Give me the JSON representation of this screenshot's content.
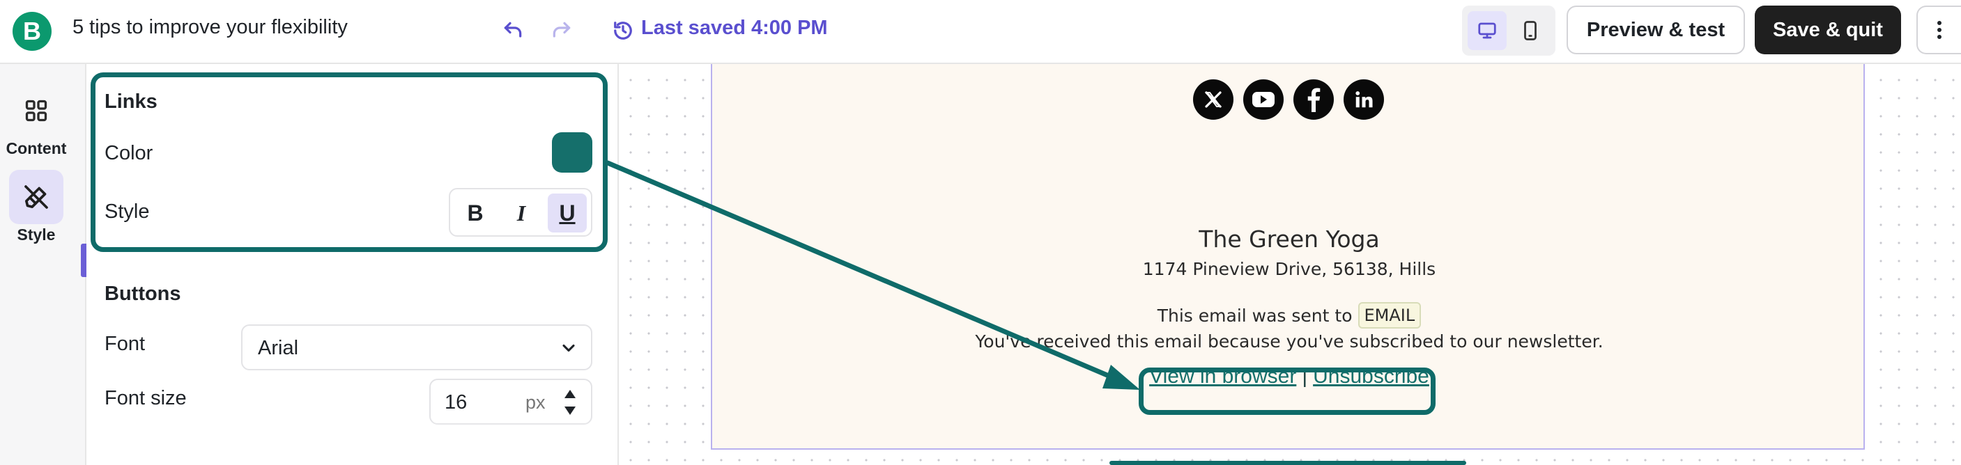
{
  "app": {
    "logo_letter": "B",
    "document_title": "5 tips to improve your flexibility",
    "last_saved": "Last saved 4:00 PM"
  },
  "toolbar": {
    "undo_icon": "undo-icon",
    "redo_icon": "redo-icon",
    "history_icon": "history-icon",
    "device_options": [
      "desktop",
      "mobile"
    ],
    "active_device": "desktop",
    "preview_label": "Preview & test",
    "save_label": "Save & quit",
    "more_icon": "more-vertical-icon"
  },
  "rail": {
    "items": [
      {
        "label": "Content",
        "icon": "grid-icon",
        "active": false
      },
      {
        "label": "Style",
        "icon": "paintbrush-icon",
        "active": true
      }
    ]
  },
  "style_panel": {
    "links": {
      "title": "Links",
      "color_label": "Color",
      "color_value": "#156f6b",
      "style_label": "Style",
      "formats": [
        {
          "label": "B",
          "name": "bold",
          "active": false
        },
        {
          "label": "I",
          "name": "italic",
          "active": false
        },
        {
          "label": "U",
          "name": "underline",
          "active": true
        }
      ]
    },
    "buttons": {
      "title": "Buttons",
      "font_label": "Font",
      "font_value": "Arial",
      "font_size_label": "Font size",
      "font_size_value": "16",
      "font_size_unit": "px"
    }
  },
  "email_footer": {
    "social": [
      "x-icon",
      "youtube-icon",
      "facebook-icon",
      "linkedin-icon"
    ],
    "company": "The Green Yoga",
    "address": "1174 Pineview Drive, 56138, Hills",
    "sent_prefix": "This email was sent to",
    "email_tag": "EMAIL",
    "reason": "You've received this email because you've subscribed to our newsletter.",
    "view_in_browser": "View in browser",
    "separator": "|",
    "unsubscribe": "Unsubscribe"
  },
  "colors": {
    "accent": "#5a4fcf",
    "link_teal": "#156f6b",
    "highlight": "#0f6b69",
    "email_bg": "#fdf8f1",
    "brand_green": "#0b996e"
  }
}
